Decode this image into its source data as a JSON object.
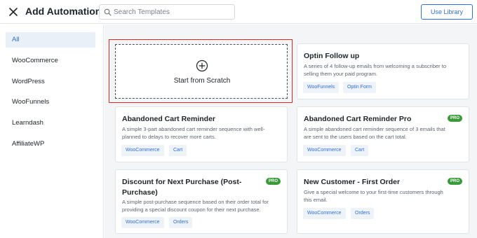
{
  "header": {
    "title": "Add Automation",
    "search_placeholder": "Search Templates",
    "right_button_label": "Use Library"
  },
  "sidebar": {
    "categories": [
      {
        "label": "All",
        "active": true
      },
      {
        "label": "WooCommerce"
      },
      {
        "label": "WordPress"
      },
      {
        "label": "WooFunnels"
      },
      {
        "label": "Learndash"
      },
      {
        "label": "AffiliateWP"
      }
    ]
  },
  "scratch": {
    "label": "Start from Scratch",
    "icon": "plus-circle-icon"
  },
  "templates": [
    {
      "title": "Optin Follow up",
      "desc_lines": [
        "A series of 4 follow-up emails from welcoming a subscriber to",
        "selling them your paid program."
      ],
      "tags": [
        "WooFunnels",
        "Optin Form"
      ],
      "pro": false
    },
    {
      "title": "Abandoned Cart Reminder",
      "desc_lines": [
        "A simple 3-part abandoned cart reminder sequence with well-",
        "planned to delays to recover more carts."
      ],
      "tags": [
        "WooCommerce",
        "Cart"
      ],
      "pro": false
    },
    {
      "title": "Abandoned Cart Reminder Pro",
      "desc_lines": [
        "A simple abandoned cart reminder sequence of 3 emails that",
        "are sent to the users based on the cart total."
      ],
      "tags": [
        "WooCommerce",
        "Cart"
      ],
      "pro": true
    },
    {
      "title_lines": [
        "Discount for Next Purchase (Post-",
        "Purchase)"
      ],
      "desc_lines": [
        "A simple post-purchase sequence based on their order total for",
        "providing a special discount coupon for their next purchase."
      ],
      "tags": [
        "WooCommerce",
        "Orders"
      ],
      "pro": true
    },
    {
      "title": "New Customer - First Order",
      "desc_lines": [
        "Give a special welcome to your first-time customers through",
        "this email."
      ],
      "tags": [
        "WooCommerce",
        "Orders"
      ],
      "pro": true
    }
  ],
  "pro_badge_label": "PRO",
  "colors": {
    "accent": "#2f6fdd",
    "pro_badge": "#3a9a3a",
    "highlight": "#e0281e"
  }
}
